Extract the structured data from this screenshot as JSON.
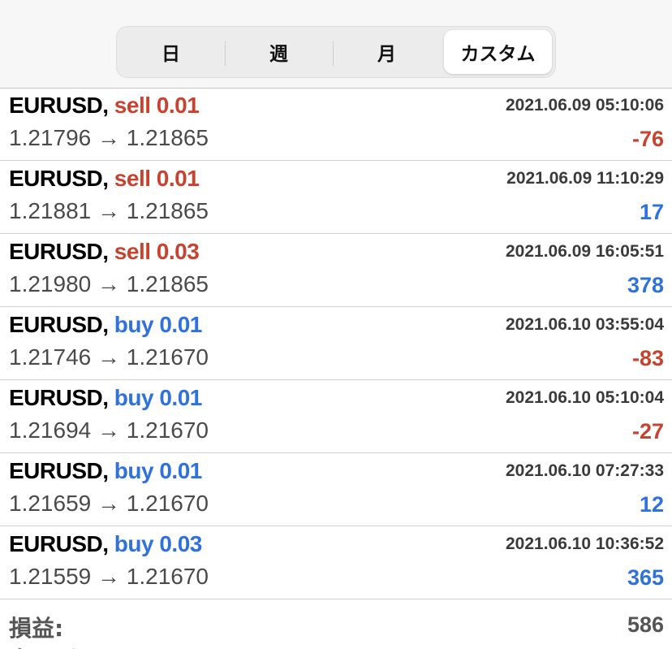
{
  "colors": {
    "sell": "#c8432f",
    "buy": "#2f72dc",
    "loss": "#c8432f",
    "profit": "#2f72dc"
  },
  "tabs": [
    {
      "label": "日",
      "active": false
    },
    {
      "label": "週",
      "active": false
    },
    {
      "label": "月",
      "active": false
    },
    {
      "label": "カスタム",
      "active": true
    }
  ],
  "trades": [
    {
      "symbol": "EURUSD,",
      "side": "sell",
      "volume": "0.01",
      "time": "2021.06.09 05:10:06",
      "open": "1.21796",
      "arrow": "→",
      "close": "1.21865",
      "pnl": "-76"
    },
    {
      "symbol": "EURUSD,",
      "side": "sell",
      "volume": "0.01",
      "time": "2021.06.09 11:10:29",
      "open": "1.21881",
      "arrow": "→",
      "close": "1.21865",
      "pnl": "17"
    },
    {
      "symbol": "EURUSD,",
      "side": "sell",
      "volume": "0.03",
      "time": "2021.06.09 16:05:51",
      "open": "1.21980",
      "arrow": "→",
      "close": "1.21865",
      "pnl": "378"
    },
    {
      "symbol": "EURUSD,",
      "side": "buy",
      "volume": "0.01",
      "time": "2021.06.10 03:55:04",
      "open": "1.21746",
      "arrow": "→",
      "close": "1.21670",
      "pnl": "-83"
    },
    {
      "symbol": "EURUSD,",
      "side": "buy",
      "volume": "0.01",
      "time": "2021.06.10 05:10:04",
      "open": "1.21694",
      "arrow": "→",
      "close": "1.21670",
      "pnl": "-27"
    },
    {
      "symbol": "EURUSD,",
      "side": "buy",
      "volume": "0.01",
      "time": "2021.06.10 07:27:33",
      "open": "1.21659",
      "arrow": "→",
      "close": "1.21670",
      "pnl": "12"
    },
    {
      "symbol": "EURUSD,",
      "side": "buy",
      "volume": "0.03",
      "time": "2021.06.10 10:36:52",
      "open": "1.21559",
      "arrow": "→",
      "close": "1.21670",
      "pnl": "365"
    }
  ],
  "summary": {
    "label": "損益:",
    "value": "586",
    "next_label": "クレジット:"
  }
}
